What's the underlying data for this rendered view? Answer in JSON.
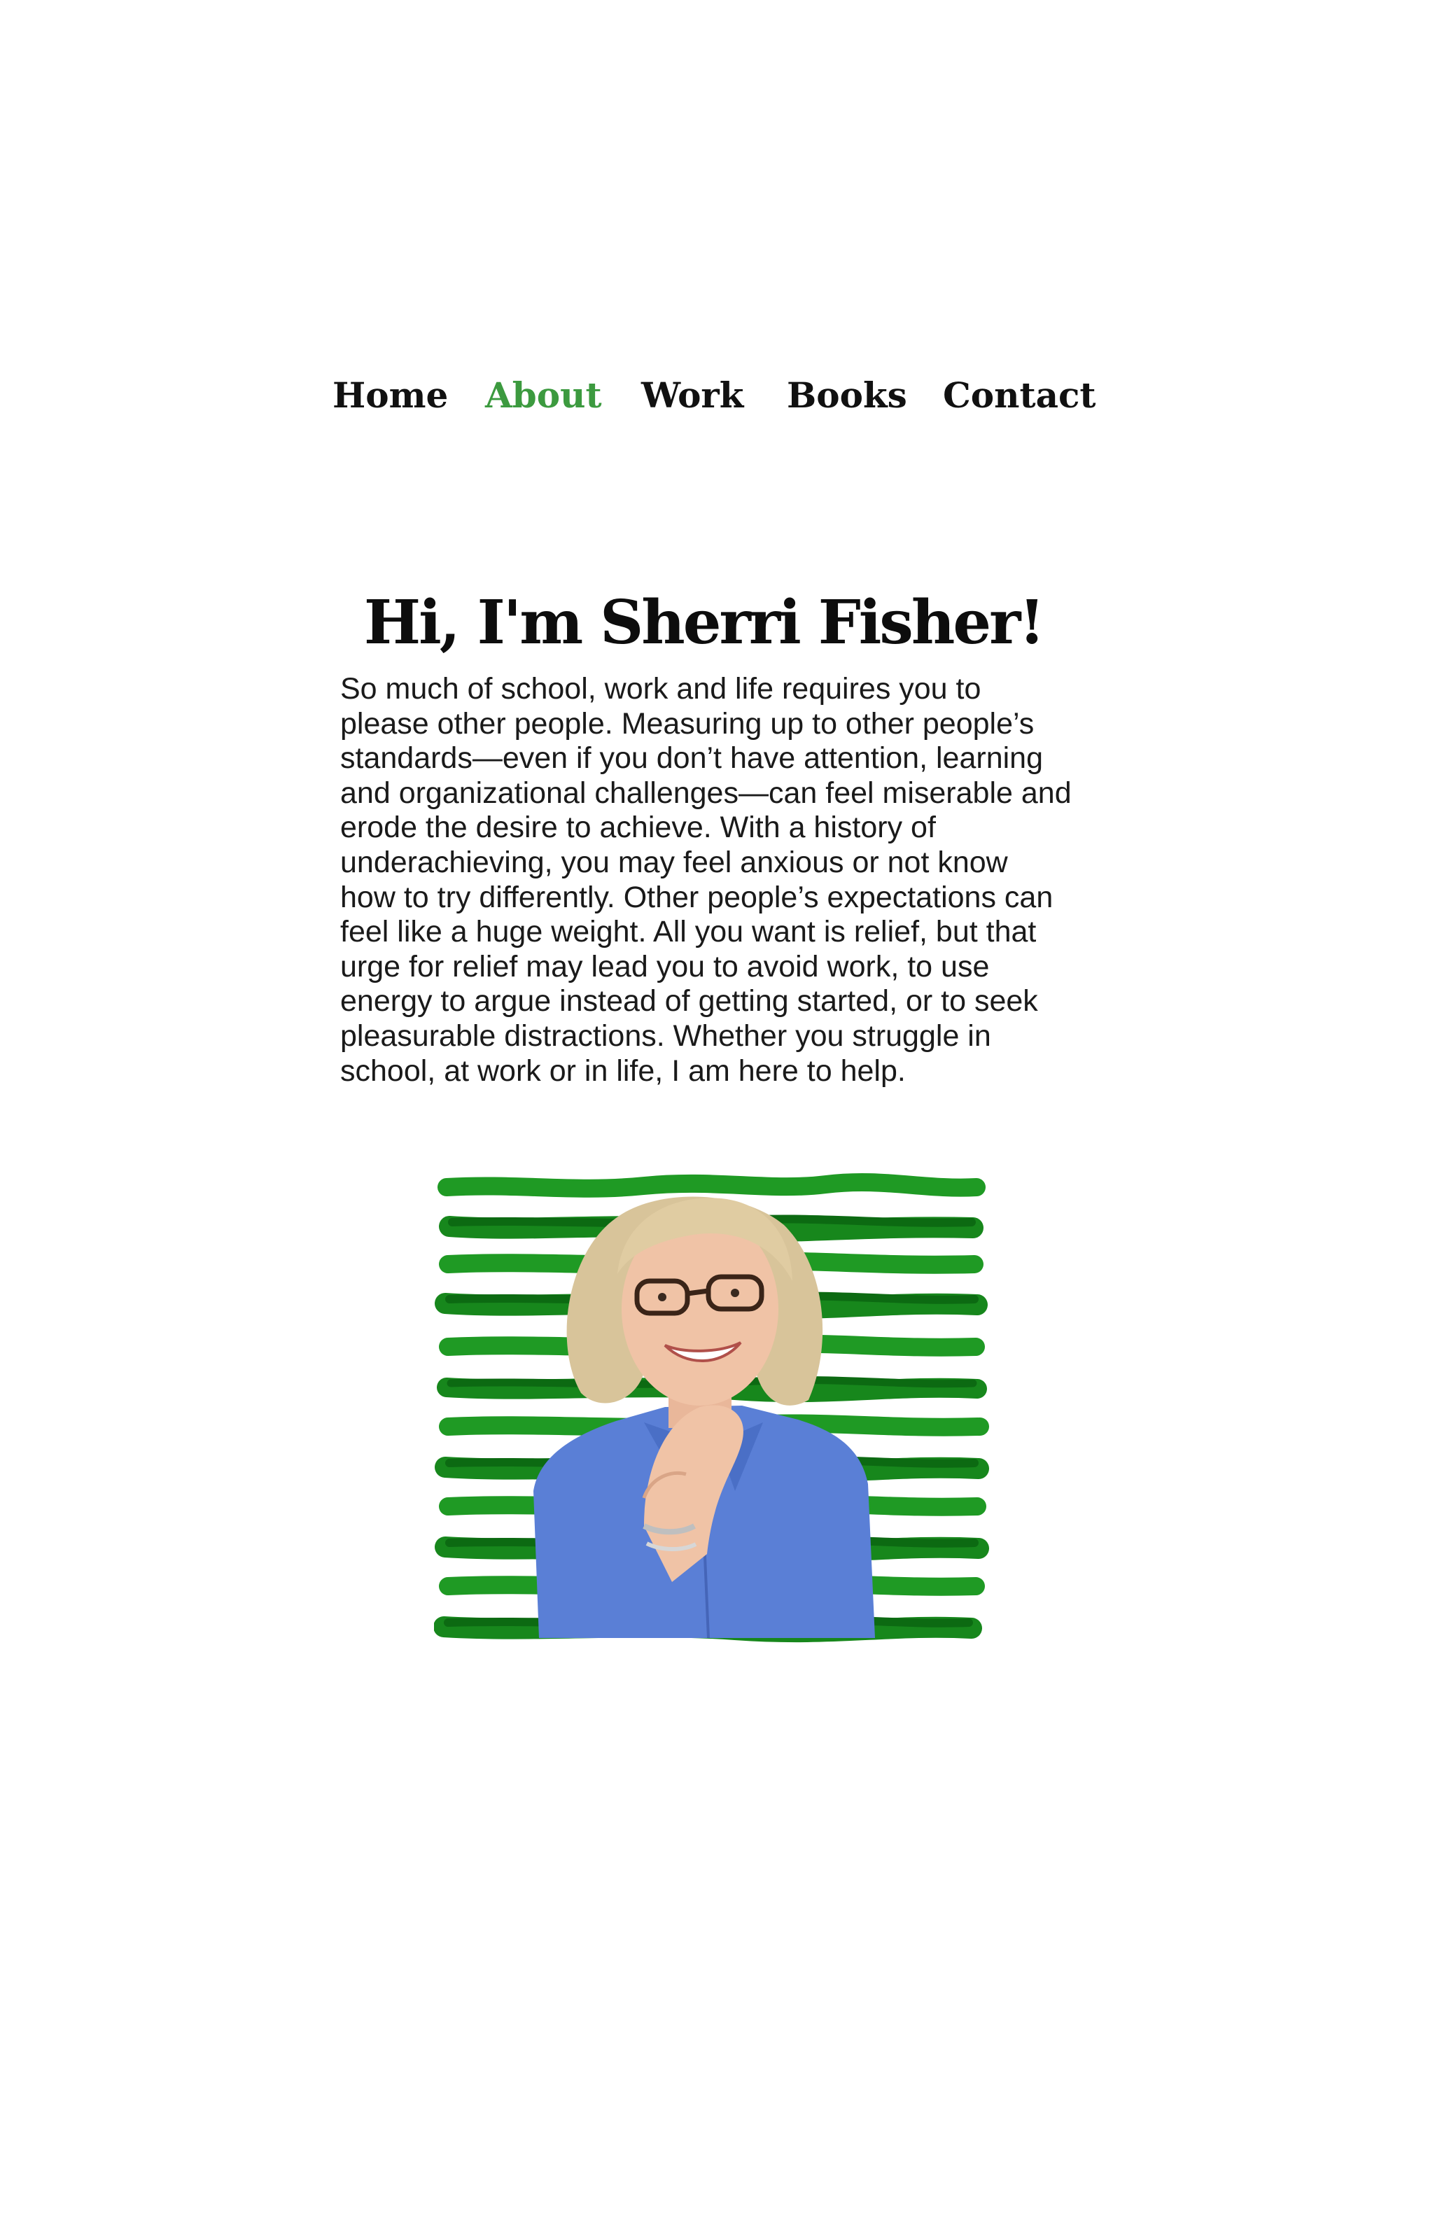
{
  "nav": {
    "items": [
      {
        "label": "Home",
        "active": false
      },
      {
        "label": "About",
        "active": true
      },
      {
        "label": "Work",
        "active": false
      },
      {
        "label": "Books",
        "active": false
      },
      {
        "label": "Contact",
        "active": false
      }
    ]
  },
  "about": {
    "heading": "Hi, I'm Sherri Fisher!",
    "intro_lines": [
      "So much of school, work and life requires you to",
      "please other people. Measuring up to other people’s",
      "standards—even if you don’t have attention, learning",
      "and organizational challenges—can feel miserable and",
      "erode the desire to achieve. With a history of",
      "underachieving, you may feel anxious or not know",
      "how to try differently. Other people’s expectations can",
      "feel like a huge weight. All you want is relief, but that",
      "urge for relief may lead you to avoid work, to use",
      "energy to argue instead of getting started, or to seek",
      "pleasurable distractions. Whether you struggle in",
      "school, at work or in life, I am here to help."
    ],
    "portrait_icon": "woman-portrait-on-green-stripes",
    "colors": {
      "accent": "#3c9a3f",
      "stripe_light": "#1f9a24",
      "stripe_dark": "#0c6a12",
      "shirt": "#5a7fd6"
    }
  }
}
